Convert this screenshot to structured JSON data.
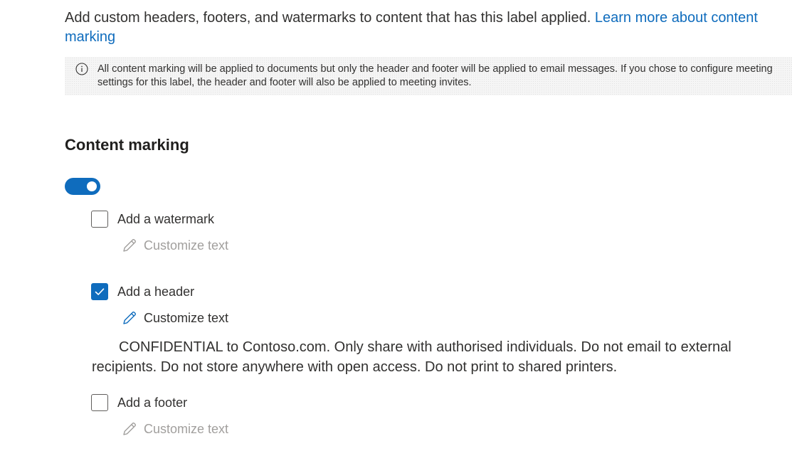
{
  "intro": {
    "text": "Add custom headers, footers, and watermarks to content that has this label applied. ",
    "link": "Learn more about content marking"
  },
  "info": {
    "icon": "info-icon",
    "text": "All content marking will be applied to documents but only the header and footer will be applied to email messages. If you chose to configure meeting settings for this label, the header and footer will also be applied to meeting invites."
  },
  "section": {
    "title": "Content marking",
    "toggle_on": true
  },
  "options": {
    "watermark": {
      "label": "Add a watermark",
      "checked": false,
      "customize_label": "Customize text",
      "customize_enabled": false
    },
    "header": {
      "label": "Add a header",
      "checked": true,
      "customize_label": "Customize text",
      "customize_enabled": true,
      "text": "CONFIDENTIAL to Contoso.com. Only share with authorised individuals. Do not email to external recipients. Do not store anywhere with open access. Do not print to shared printers."
    },
    "footer": {
      "label": "Add a footer",
      "checked": false,
      "customize_label": "Customize text",
      "customize_enabled": false
    }
  },
  "colors": {
    "accent": "#0f6cbd",
    "disabled_text": "#a19f9d",
    "text": "#323130"
  }
}
